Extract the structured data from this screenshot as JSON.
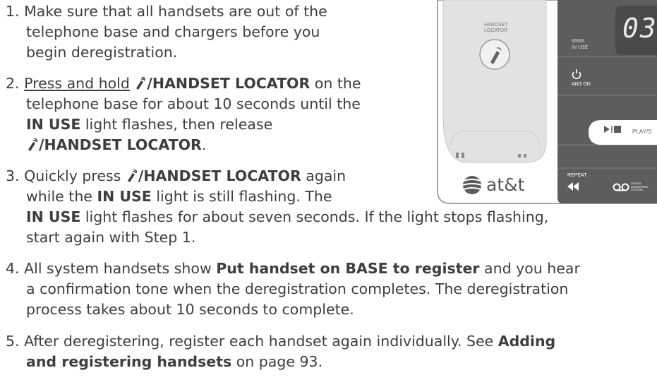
{
  "steps": [
    {
      "num": "1.",
      "lines": [
        "Make sure that all handsets are out of the",
        "telephone base and chargers before you",
        "begin deregistration."
      ]
    },
    {
      "num": "2.",
      "press_hold": "Press and hold",
      "locator": "/HANDSET LOCATOR",
      "l1_tail": " on the",
      "l2": "telephone base for about 10 seconds until the",
      "in_use": "IN USE",
      "l3_tail": " light flashes, then release",
      "l4_locator": "/HANDSET LOCATOR",
      "l4_tail": "."
    },
    {
      "num": "3.",
      "l1_pre": "Quickly press ",
      "locator": "/HANDSET LOCATOR",
      "l1_tail": " again",
      "l2_pre": "while the ",
      "in_use": "IN USE",
      "l2_tail": " light is still flashing. The",
      "l3_in_use": "IN USE",
      "l3_tail": " light flashes for about seven seconds. If the light stops flashing,",
      "l4": "start again with Step 1."
    },
    {
      "num": "4.",
      "l1_pre": "All system handsets show ",
      "message": "Put handset on BASE to register",
      "l1_tail": " and you hear",
      "l2": "a confirmation tone when the deregistration completes. The deregistration",
      "l3": "process takes about 10 seconds to complete."
    },
    {
      "num": "5.",
      "l1_pre": "After deregistering, register each handset again individually. See ",
      "link_a": "Adding",
      "link_b": "and registering handsets",
      "l2_tail": " on page 93."
    }
  ],
  "base_panel": {
    "handset_locator": [
      "HANDSET",
      "LOCATOR"
    ],
    "in_use": "IN USE",
    "display": "03",
    "ans_on": "ANS ON",
    "play": "PLAY/S",
    "repeat": "REPEAT",
    "brand": "at&t",
    "das": [
      "DIGITAL",
      "ANSWERING",
      "SYSTEM"
    ]
  },
  "colors": {
    "text": "#3e3e3e",
    "panel_dark": "#5d5d5d",
    "panel_light": "#e3e3e3"
  }
}
